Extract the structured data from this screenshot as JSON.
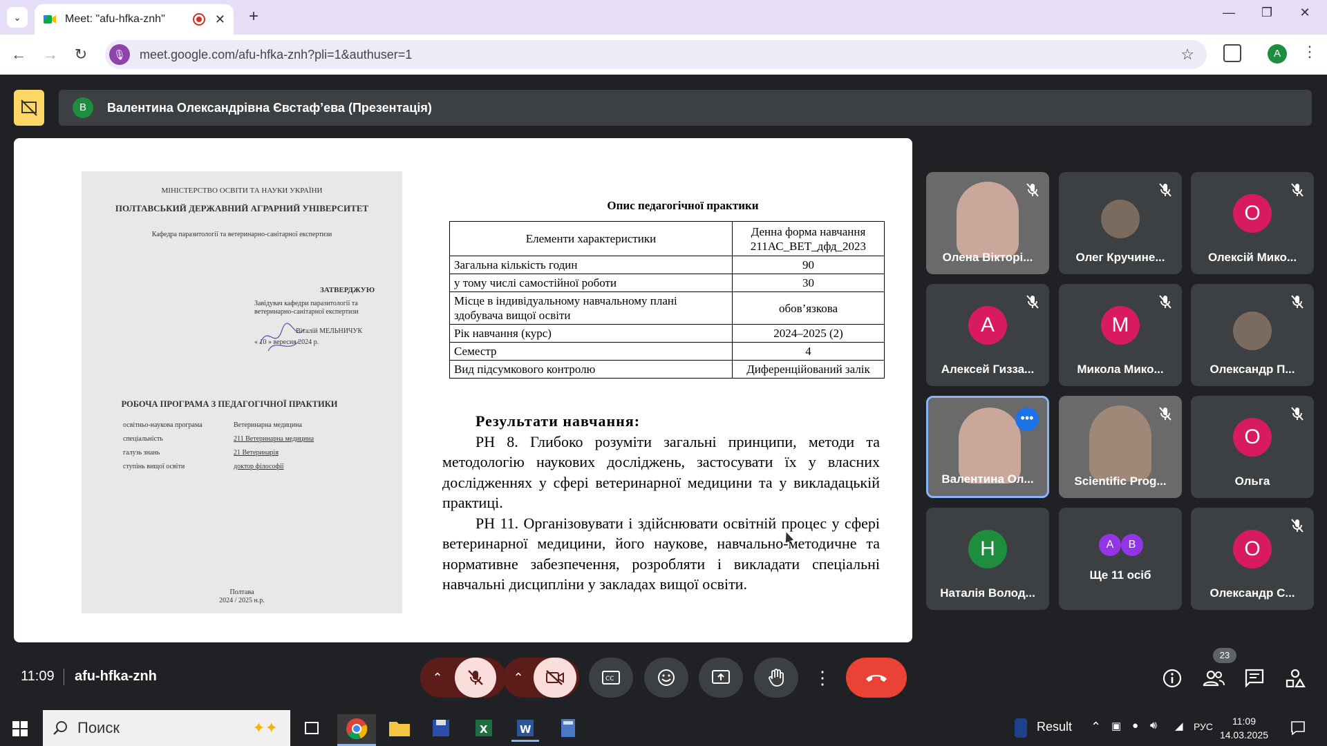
{
  "browser": {
    "tab_title": "Meet: \"afu-hfka-znh\"",
    "url": "meet.google.com/afu-hfka-znh?pli=1&authuser=1",
    "profile_letter": "A"
  },
  "presenter": {
    "avatar": "В",
    "name": "Валентина Олександрівна Євстаф’ева (Презентація)"
  },
  "document": {
    "ministry": "МІНІСТЕРСТВО ОСВІТИ ТА НАУКИ УКРАЇНИ",
    "university": "ПОЛТАВСЬКИЙ ДЕРЖАВНИЙ АГРАРНИЙ УНІВЕРСИТЕТ",
    "department": "Кафедра паразитології та ветеринарно-санітарної експертизи",
    "approve": "ЗАТВЕРДЖУЮ",
    "head1": "Завідувач  кафедри  паразитології  та",
    "head2": "ветеринарно-санітарної експертизи",
    "signer": "Віталій   МЕЛЬНИЧУК",
    "date": "« 10 » вересня 2024 р.",
    "program_title": "РОБОЧА ПРОГРАМА З ПЕДАГОГІЧНОЇ ПРАКТИКИ",
    "rows": [
      {
        "k": "освітньо-наукова програма",
        "v": "Ветеринарна медицина"
      },
      {
        "k": "спеціальність",
        "v": "211 Ветеринарна медицина"
      },
      {
        "k": "галузь знань",
        "v": "21 Ветеринарія"
      },
      {
        "k": "ступінь вищої освіти",
        "v": "доктор філософії"
      }
    ],
    "city": "Полтава",
    "years": "2024 / 2025 н.р."
  },
  "spec_table": {
    "title": "Опис педагогічної практики",
    "header": [
      "Елементи характеристики",
      "Денна форма навчання 211АС_ВЕТ_дфд_2023"
    ],
    "rows": [
      [
        "Загальна кількість годин",
        "90"
      ],
      [
        "у тому числі самостійної роботи",
        "30"
      ],
      [
        "Місце в індивідуальному навчальному плані здобувача вищої освіти",
        "обов’язкова"
      ],
      [
        "Рік навчання (курс)",
        "2024–2025 (2)"
      ],
      [
        "Семестр",
        "4"
      ],
      [
        "Вид підсумкового контролю",
        "Диференційований залік"
      ]
    ]
  },
  "results": {
    "heading": "Результати навчання:",
    "p1": "РН 8. Глибоко розуміти загальні принципи, методи та методологію наукових досліджень, застосувати їх у власних дослідженнях у сфері ветеринарної медицини та у викладацькій практиці.",
    "p2": "РН 11. Організовувати і здійснювати освітній процес у сфері ветеринарної медицини, його наукове, навчально-методичне та нормативне забезпечення, розробляти і викладати спеціальні навчальні дисципліни у закладах вищої освіти."
  },
  "participants": [
    {
      "name": "Олена Вікторі...",
      "type": "video"
    },
    {
      "name": "Олег Кручине...",
      "type": "photo"
    },
    {
      "name": "Олексій Мико...",
      "letter": "О",
      "color": "#d81b60"
    },
    {
      "name": "Алексей Гизза...",
      "letter": "А",
      "color": "#d81b60"
    },
    {
      "name": "Микола Мико...",
      "letter": "М",
      "color": "#d81b60"
    },
    {
      "name": "Олександр П...",
      "type": "photo"
    },
    {
      "name": "Валентина Ол...",
      "type": "video"
    },
    {
      "name": "Scientific Prog...",
      "type": "video"
    },
    {
      "name": "Ольга",
      "letter": "О",
      "color": "#d81b60"
    },
    {
      "name": "Наталія Волод...",
      "letter": "Н",
      "color": "#1e8e3e"
    },
    {
      "name": "Ще 11 осіб",
      "letters": [
        "А",
        "В"
      ]
    },
    {
      "name": "Олександр С...",
      "letter": "О",
      "color": "#d81b60"
    }
  ],
  "meeting": {
    "time": "11:09",
    "code": "afu-hfka-znh",
    "participants_count": "23"
  },
  "taskbar": {
    "search": "Поиск",
    "result": "Result",
    "lang": "РУС",
    "time": "11:09",
    "date": "14.03.2025"
  }
}
